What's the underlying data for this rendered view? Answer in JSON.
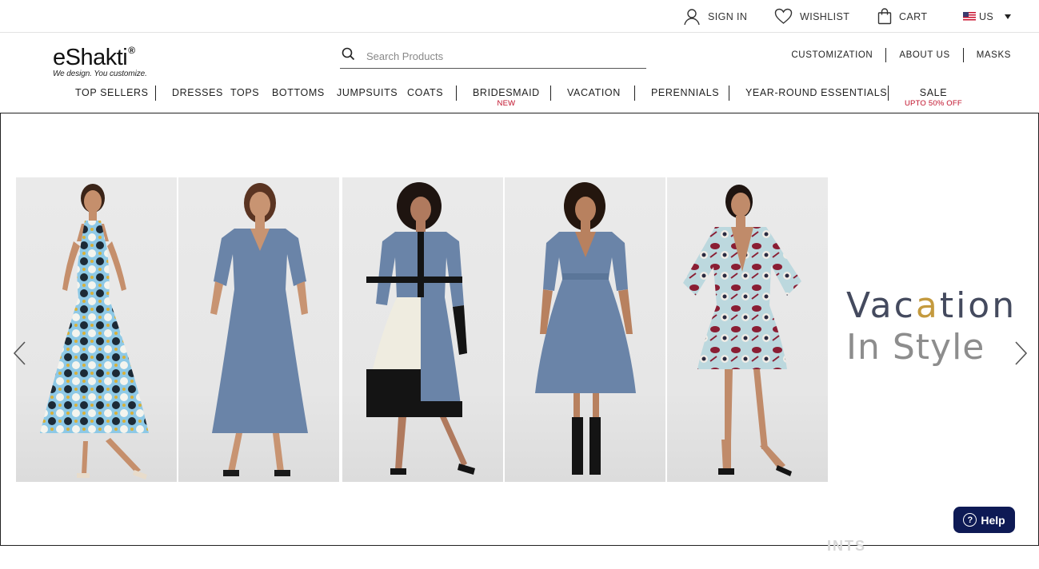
{
  "topbar": {
    "sign_in": "SIGN IN",
    "wishlist": "WISHLIST",
    "cart": "CART",
    "country": "US",
    "icons": [
      "user-icon",
      "heart-icon",
      "shopping-bag-icon",
      "us-flag-icon",
      "chevron-down-icon"
    ]
  },
  "header": {
    "logo_name": "eShakti",
    "logo_mark": "®",
    "logo_tagline": "We design. You customize.",
    "search_placeholder": "Search Products",
    "links": [
      "CUSTOMIZATION",
      "ABOUT US",
      "MASKS"
    ]
  },
  "nav": {
    "items": [
      {
        "label": "TOP SELLERS",
        "sub": ""
      },
      {
        "label": "DRESSES",
        "sub": ""
      },
      {
        "label": "TOPS",
        "sub": ""
      },
      {
        "label": "BOTTOMS",
        "sub": ""
      },
      {
        "label": "JUMPSUITS",
        "sub": ""
      },
      {
        "label": "COATS",
        "sub": ""
      },
      {
        "label": "BRIDESMAID",
        "sub": "NEW"
      },
      {
        "label": "VACATION",
        "sub": ""
      },
      {
        "label": "PERENNIALS",
        "sub": ""
      },
      {
        "label": "YEAR-ROUND ESSENTIALS",
        "sub": ""
      },
      {
        "label": "SALE",
        "sub": "UPTO 50% OFF"
      }
    ]
  },
  "hero": {
    "headline_line1_a": "Vac",
    "headline_line1_b": "a",
    "headline_line1_c": "tion",
    "headline_line2": "In Style",
    "products": [
      {
        "name": "halter-print-maxi-dress",
        "colors": {
          "dress": "#8ec9e6",
          "pattern": "#1c2a36",
          "skin": "#c58f6c",
          "hair": "#3a2418"
        }
      },
      {
        "name": "blue-wrap-midi-dress",
        "colors": {
          "dress": "#6a84a8",
          "skin": "#c89472",
          "hair": "#5a3422"
        }
      },
      {
        "name": "colorblock-midi-dress",
        "colors": {
          "dress": "#6a84a8",
          "block_light": "#efece0",
          "block_dark": "#141414",
          "skin": "#b07a5e",
          "hair": "#1e1410"
        }
      },
      {
        "name": "blue-fit-flare-dress",
        "colors": {
          "dress": "#6a84a8",
          "skin": "#b8815f",
          "hair": "#24160e"
        }
      },
      {
        "name": "paisley-print-dress",
        "colors": {
          "dress": "#bcd8de",
          "pattern": "#8a1e34",
          "skin": "#c08b6a",
          "hair": "#1e1410"
        }
      }
    ],
    "arrows": [
      "chevron-left-icon",
      "chevron-right-icon"
    ]
  },
  "help": {
    "label": "Help",
    "icon": "question-icon"
  },
  "ghost_text": "INTS"
}
